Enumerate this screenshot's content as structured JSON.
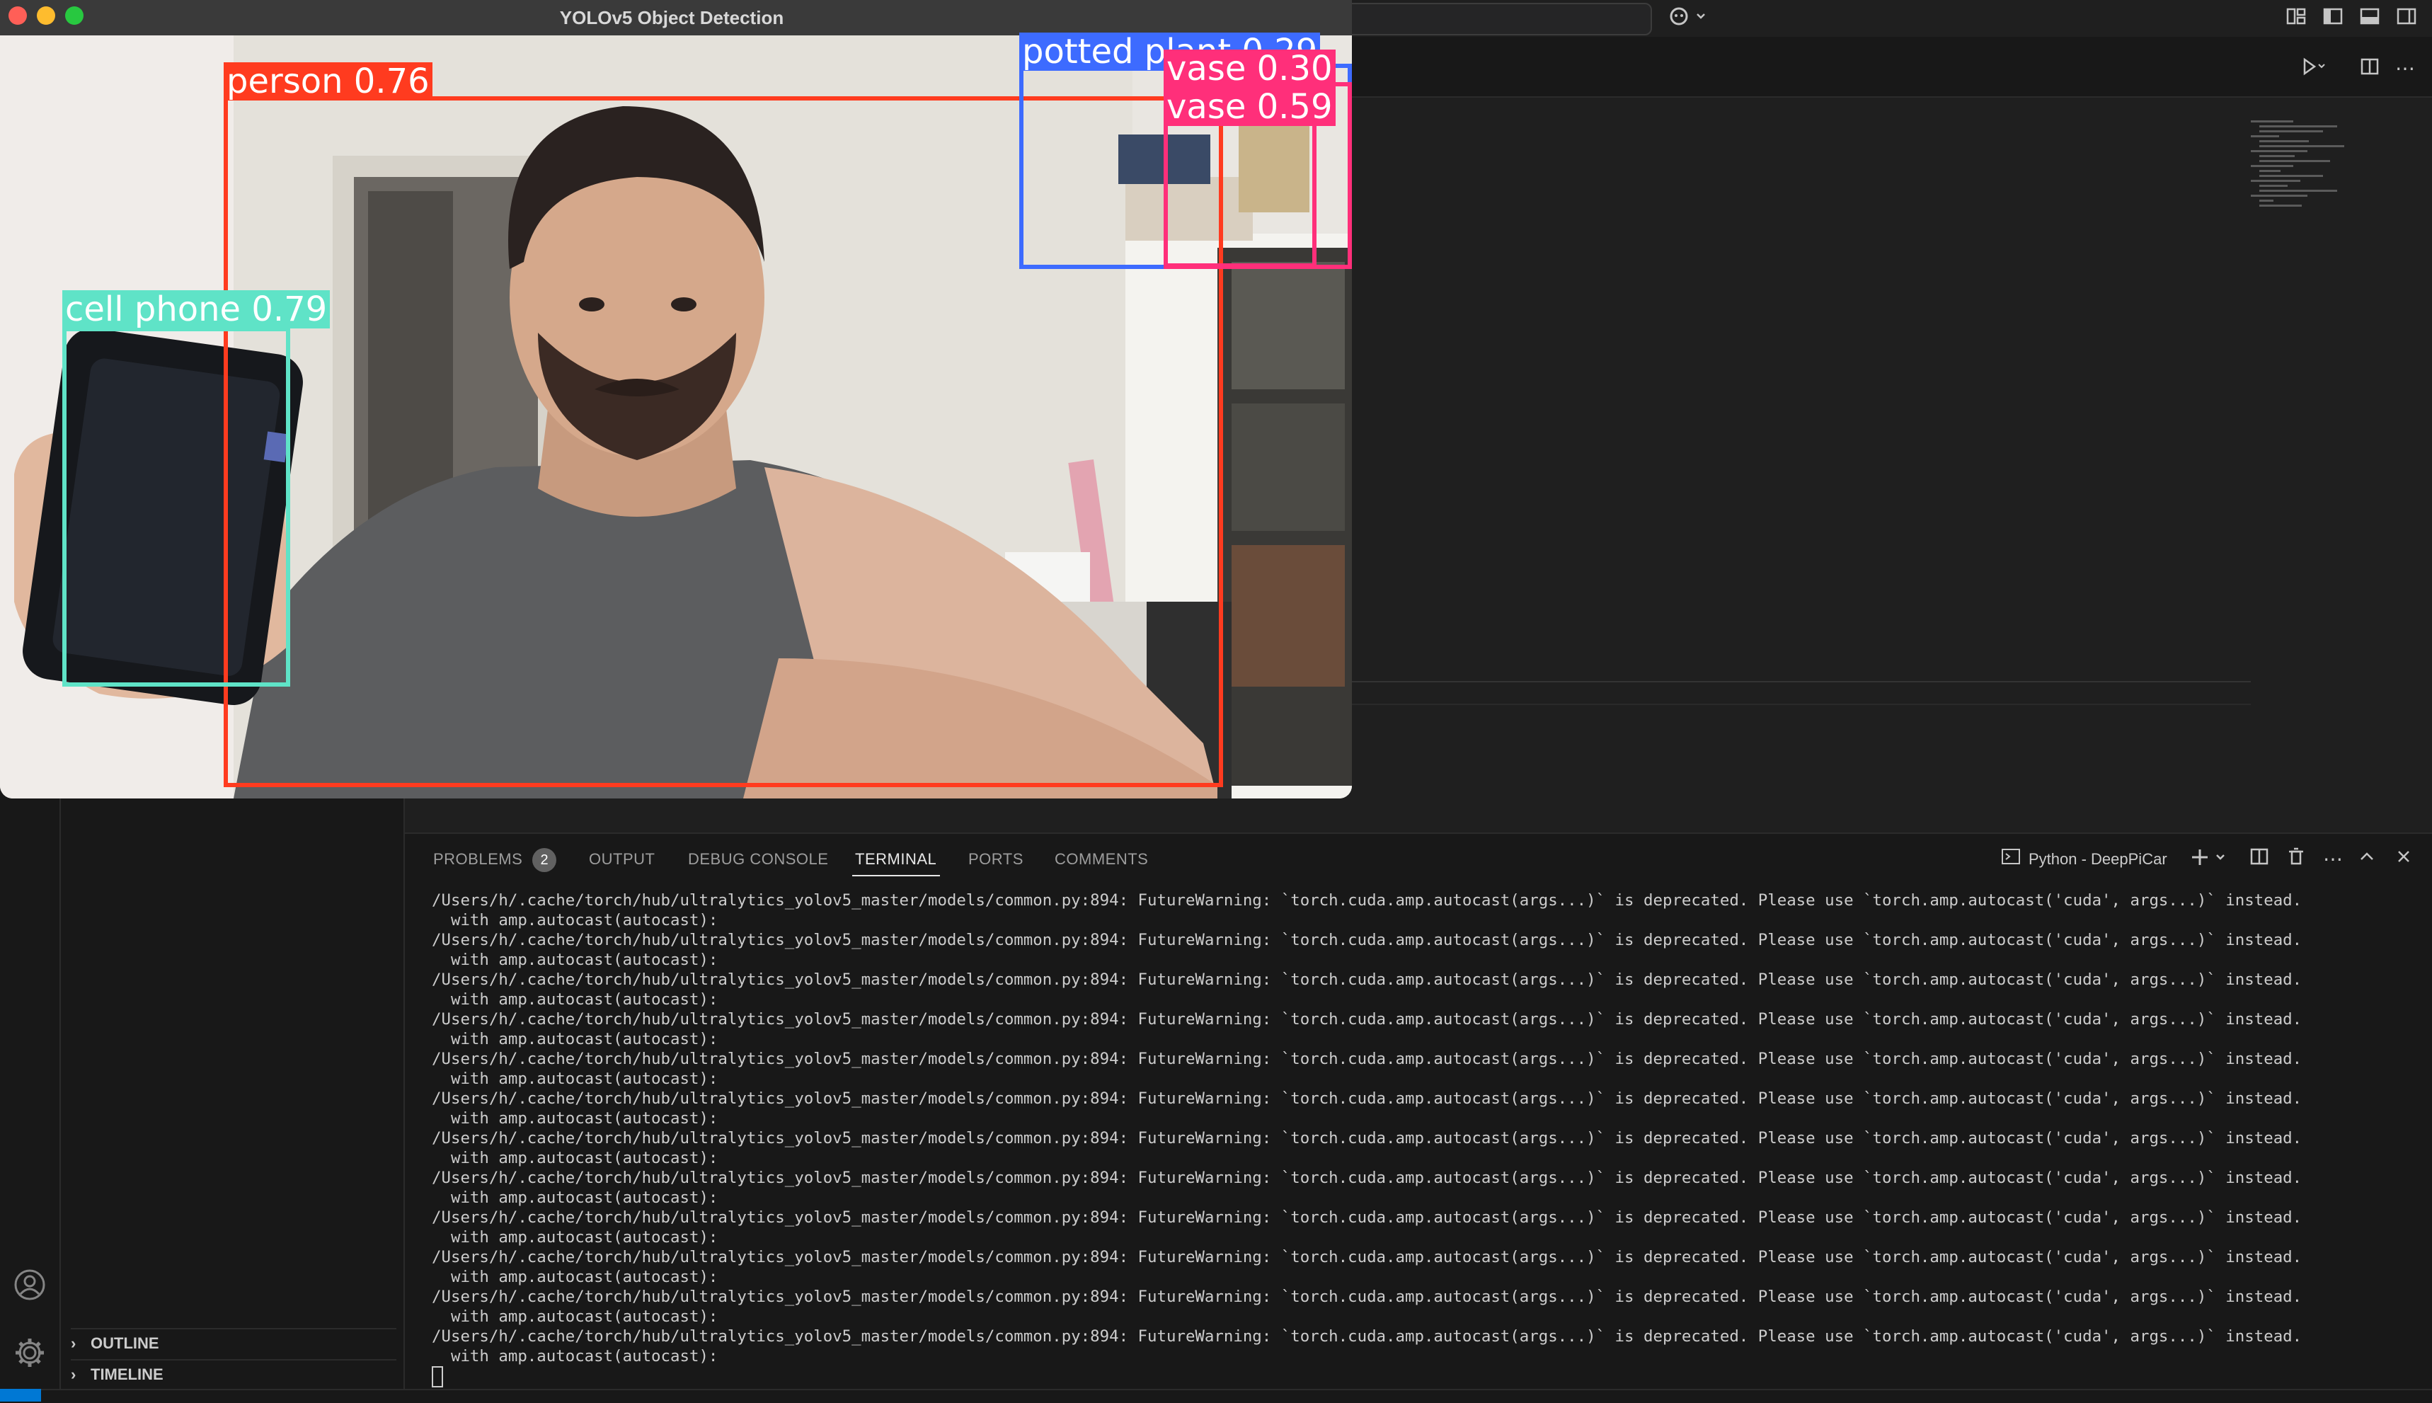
{
  "yolo_window": {
    "title": "YOLOv5 Object Detection",
    "detections": [
      {
        "label": "person 0.76",
        "color": "#ff3b1f"
      },
      {
        "label": "cell phone 0.79",
        "color": "#5fe3c7"
      },
      {
        "label": "potted plant 0.29",
        "color": "#3d6bff"
      },
      {
        "label": "vase 0.30",
        "color": "#ff2f7a"
      },
      {
        "label": "vase 0.59",
        "color": "#ff2f7a"
      }
    ]
  },
  "sidebar": {
    "outline_label": "OUTLINE",
    "timeline_label": "TIMELINE"
  },
  "panel": {
    "tabs": {
      "problems": "PROBLEMS",
      "problems_count": "2",
      "output": "OUTPUT",
      "debug_console": "DEBUG CONSOLE",
      "terminal": "TERMINAL",
      "ports": "PORTS",
      "comments": "COMMENTS"
    },
    "terminal_name": "Python - DeepPiCar",
    "terminal_lines": [
      "/Users/h/.cache/torch/hub/ultralytics_yolov5_master/models/common.py:894: FutureWarning: `torch.cuda.amp.autocast(args...)` is deprecated. Please use `torch.amp.autocast('cuda', args...)` instead.",
      "  with amp.autocast(autocast):",
      "/Users/h/.cache/torch/hub/ultralytics_yolov5_master/models/common.py:894: FutureWarning: `torch.cuda.amp.autocast(args...)` is deprecated. Please use `torch.amp.autocast('cuda', args...)` instead.",
      "  with amp.autocast(autocast):",
      "/Users/h/.cache/torch/hub/ultralytics_yolov5_master/models/common.py:894: FutureWarning: `torch.cuda.amp.autocast(args...)` is deprecated. Please use `torch.amp.autocast('cuda', args...)` instead.",
      "  with amp.autocast(autocast):",
      "/Users/h/.cache/torch/hub/ultralytics_yolov5_master/models/common.py:894: FutureWarning: `torch.cuda.amp.autocast(args...)` is deprecated. Please use `torch.amp.autocast('cuda', args...)` instead.",
      "  with amp.autocast(autocast):",
      "/Users/h/.cache/torch/hub/ultralytics_yolov5_master/models/common.py:894: FutureWarning: `torch.cuda.amp.autocast(args...)` is deprecated. Please use `torch.amp.autocast('cuda', args...)` instead.",
      "  with amp.autocast(autocast):",
      "/Users/h/.cache/torch/hub/ultralytics_yolov5_master/models/common.py:894: FutureWarning: `torch.cuda.amp.autocast(args...)` is deprecated. Please use `torch.amp.autocast('cuda', args...)` instead.",
      "  with amp.autocast(autocast):",
      "/Users/h/.cache/torch/hub/ultralytics_yolov5_master/models/common.py:894: FutureWarning: `torch.cuda.amp.autocast(args...)` is deprecated. Please use `torch.amp.autocast('cuda', args...)` instead.",
      "  with amp.autocast(autocast):",
      "/Users/h/.cache/torch/hub/ultralytics_yolov5_master/models/common.py:894: FutureWarning: `torch.cuda.amp.autocast(args...)` is deprecated. Please use `torch.amp.autocast('cuda', args...)` instead.",
      "  with amp.autocast(autocast):",
      "/Users/h/.cache/torch/hub/ultralytics_yolov5_master/models/common.py:894: FutureWarning: `torch.cuda.amp.autocast(args...)` is deprecated. Please use `torch.amp.autocast('cuda', args...)` instead.",
      "  with amp.autocast(autocast):",
      "/Users/h/.cache/torch/hub/ultralytics_yolov5_master/models/common.py:894: FutureWarning: `torch.cuda.amp.autocast(args...)` is deprecated. Please use `torch.amp.autocast('cuda', args...)` instead.",
      "  with amp.autocast(autocast):",
      "/Users/h/.cache/torch/hub/ultralytics_yolov5_master/models/common.py:894: FutureWarning: `torch.cuda.amp.autocast(args...)` is deprecated. Please use `torch.amp.autocast('cuda', args...)` instead.",
      "  with amp.autocast(autocast):",
      "/Users/h/.cache/torch/hub/ultralytics_yolov5_master/models/common.py:894: FutureWarning: `torch.cuda.amp.autocast(args...)` is deprecated. Please use `torch.amp.autocast('cuda', args...)` instead.",
      "  with amp.autocast(autocast):"
    ]
  },
  "icons": {
    "copilot": "copilot-icon",
    "layout": [
      "customize-layout-icon",
      "toggle-primary-sidebar-icon",
      "toggle-panel-icon",
      "toggle-secondary-sidebar-icon"
    ],
    "editor": [
      "run-icon",
      "split-editor-icon",
      "more-actions-icon"
    ],
    "panel": [
      "terminal-icon",
      "new-terminal-icon",
      "split-terminal-icon",
      "kill-terminal-icon",
      "more-icon",
      "maximize-panel-icon",
      "close-panel-icon"
    ],
    "activity": [
      "accounts-icon",
      "manage-gear-icon"
    ]
  }
}
